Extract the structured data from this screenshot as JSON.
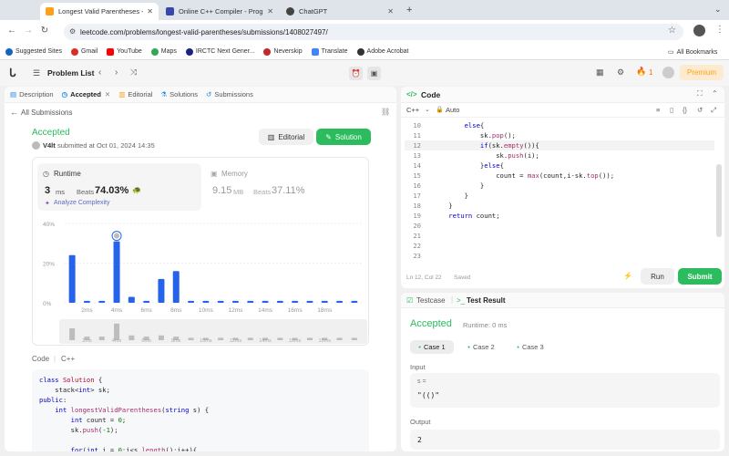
{
  "browser": {
    "tabs": [
      {
        "title": "Longest Valid Parentheses - L",
        "color": "#ffa116",
        "active": true
      },
      {
        "title": "Online C++ Compiler - Progra",
        "color": "#3949ab",
        "active": false
      },
      {
        "title": "ChatGPT",
        "color": "#444",
        "active": false
      }
    ],
    "new_tab": "+",
    "url": "leetcode.com/problems/longest-valid-parentheses/submissions/1408027497/",
    "bookmarks": [
      {
        "label": "Suggested Sites",
        "color": "#1565c0"
      },
      {
        "label": "Gmail",
        "color": "#d93025"
      },
      {
        "label": "YouTube",
        "color": "#ff0000"
      },
      {
        "label": "Maps",
        "color": "#34a853"
      },
      {
        "label": "IRCTC Next Gener...",
        "color": "#1a237e"
      },
      {
        "label": "Neverskip",
        "color": "#c62828"
      },
      {
        "label": "Translate",
        "color": "#4285f4"
      },
      {
        "label": "Adobe Acrobat",
        "color": "#333"
      }
    ],
    "all_bookmarks": "All Bookmarks"
  },
  "nav": {
    "problem_list": "Problem List",
    "streak": "1",
    "premium": "Premium"
  },
  "left_tabs": [
    {
      "label": "Description",
      "icon": "doc-icon"
    },
    {
      "label": "Accepted",
      "icon": "clock-icon",
      "active": true
    },
    {
      "label": "Editorial",
      "icon": "book-icon"
    },
    {
      "label": "Solutions",
      "icon": "flask-icon"
    },
    {
      "label": "Submissions",
      "icon": "history-icon"
    }
  ],
  "submission": {
    "back": "All Submissions",
    "status": "Accepted",
    "user": "V4lt",
    "submitted": "submitted at Oct 01, 2024 14:35",
    "editorial_btn": "Editorial",
    "solution_btn": "Solution",
    "runtime_label": "Runtime",
    "runtime_value": "3",
    "runtime_unit": "ms",
    "beats_label": "Beats",
    "runtime_beats": "74.03%",
    "analyze": "Analyze Complexity",
    "memory_label": "Memory",
    "memory_value": "9.15",
    "memory_unit": "MB",
    "memory_beats": "37.11%",
    "code_label": "Code",
    "code_lang": "C++"
  },
  "chart_data": {
    "type": "bar",
    "y_ticks": [
      "40%",
      "20%",
      "0%"
    ],
    "ylim": [
      0,
      40
    ],
    "x_ticks": [
      "2ms",
      "4ms",
      "6ms",
      "8ms",
      "10ms",
      "12ms",
      "14ms",
      "16ms",
      "18ms"
    ],
    "values": [
      24,
      1,
      1,
      31,
      3,
      1,
      12,
      16,
      1,
      1,
      1,
      1,
      1,
      1,
      1,
      1,
      1,
      1,
      1,
      1
    ],
    "highlight_index": 3,
    "mini_ticks": [
      "2ms",
      "4ms",
      "6ms",
      "8ms",
      "10ms",
      "12ms",
      "14ms",
      "16ms",
      "18ms"
    ],
    "mini_values": [
      10,
      3,
      3,
      14,
      4,
      3,
      4,
      3,
      2,
      2,
      2,
      2,
      2,
      2,
      2,
      2,
      2,
      2,
      2,
      2
    ]
  },
  "left_code": [
    "class Solution {",
    "    stack<int> sk;",
    "public:",
    "    int longestValidParentheses(string s) {",
    "        int count = 0;",
    "        sk.push(-1);",
    "",
    "        for(int i = 0;i<s.length();i++){"
  ],
  "editor": {
    "title": "Code",
    "lang": "C++",
    "mode": "Auto",
    "lines": [
      {
        "n": "10",
        "t": "        else{"
      },
      {
        "n": "11",
        "t": "            sk.pop();"
      },
      {
        "n": "12",
        "t": "            if(sk.empty()){"
      },
      {
        "n": "13",
        "t": "                sk.push(i);"
      },
      {
        "n": "14",
        "t": "            }else{"
      },
      {
        "n": "15",
        "t": "                count = max(count,i-sk.top());"
      },
      {
        "n": "16",
        "t": "            }"
      },
      {
        "n": "17",
        "t": "        }"
      },
      {
        "n": "18",
        "t": "    }"
      },
      {
        "n": "19",
        "t": "    return count;"
      },
      {
        "n": "20",
        "t": ""
      },
      {
        "n": "21",
        "t": ""
      },
      {
        "n": "22",
        "t": ""
      },
      {
        "n": "23",
        "t": ""
      }
    ],
    "status": "Ln 12, Col 22",
    "saved": "Saved",
    "run": "Run",
    "submit": "Submit"
  },
  "test": {
    "testcase_tab": "Testcase",
    "result_tab": "Test Result",
    "status": "Accepted",
    "runtime": "Runtime: 0 ms",
    "cases": [
      "Case 1",
      "Case 2",
      "Case 3"
    ],
    "input_label": "Input",
    "var": "s =",
    "input_value": "\"(()\"",
    "output_label": "Output",
    "output_value": "2"
  }
}
